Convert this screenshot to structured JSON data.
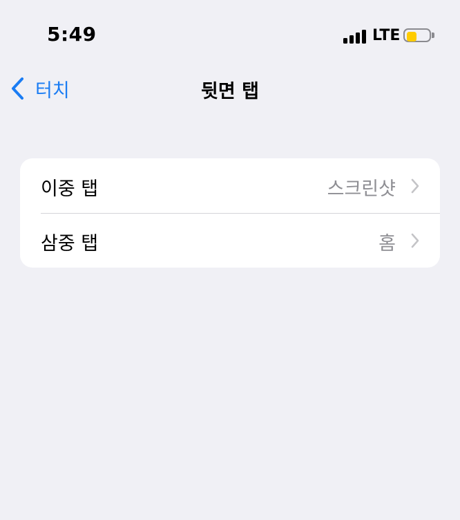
{
  "status_bar": {
    "time": "5:49",
    "network": "LTE",
    "signal_bars": 4,
    "battery_level": 0.45,
    "battery_color": "#ffcc00",
    "icons": [
      "signal-icon",
      "battery-icon"
    ]
  },
  "nav": {
    "back_label": "터치",
    "back_icon": "chevron-left-icon",
    "title": "뒷면 탭",
    "accent_color": "#1a7cf3"
  },
  "settings": {
    "rows": [
      {
        "label": "이중 탭",
        "value": "스크린샷",
        "icon": "chevron-right-icon"
      },
      {
        "label": "삼중 탭",
        "value": "홈",
        "icon": "chevron-right-icon"
      }
    ]
  }
}
